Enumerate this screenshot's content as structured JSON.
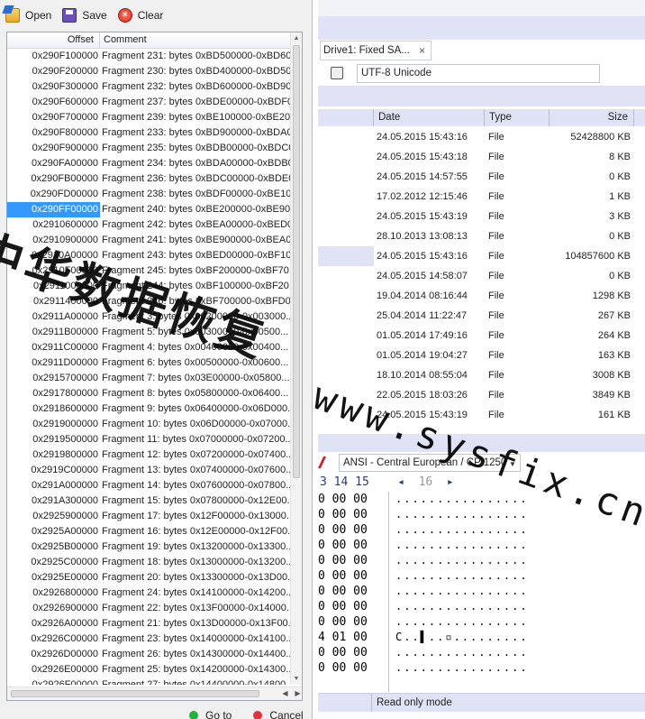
{
  "toolbar": {
    "open_label": "Open",
    "save_label": "Save",
    "clear_label": "Clear"
  },
  "list": {
    "headers": {
      "offset": "Offset",
      "comment": "Comment"
    },
    "rows": [
      {
        "offset": "0x290F100000",
        "comment": "Fragment 231: bytes 0xBD500000-0xBD60..."
      },
      {
        "offset": "0x290F200000",
        "comment": "Fragment 230: bytes 0xBD400000-0xBD50..."
      },
      {
        "offset": "0x290F300000",
        "comment": "Fragment 232: bytes 0xBD600000-0xBD90..."
      },
      {
        "offset": "0x290F600000",
        "comment": "Fragment 237: bytes 0xBDE00000-0xBDF0..."
      },
      {
        "offset": "0x290F700000",
        "comment": "Fragment 239: bytes 0xBE100000-0xBE20..."
      },
      {
        "offset": "0x290F800000",
        "comment": "Fragment 233: bytes 0xBD900000-0xBDA0..."
      },
      {
        "offset": "0x290F900000",
        "comment": "Fragment 235: bytes 0xBDB00000-0xBDC0..."
      },
      {
        "offset": "0x290FA00000",
        "comment": "Fragment 234: bytes 0xBDA00000-0xBDB0..."
      },
      {
        "offset": "0x290FB00000",
        "comment": "Fragment 236: bytes 0xBDC00000-0xBDE0..."
      },
      {
        "offset": "0x290FD00000",
        "comment": "Fragment 238: bytes 0xBDF00000-0xBE10..."
      },
      {
        "offset": "0x290FF00000",
        "comment": "Fragment 240: bytes 0xBE200000-0xBE90...",
        "selected": true
      },
      {
        "offset": "0x2910600000",
        "comment": "Fragment 242: bytes 0xBEA00000-0xBED0..."
      },
      {
        "offset": "0x2910900000",
        "comment": "Fragment 241: bytes 0xBE900000-0xBEA0..."
      },
      {
        "offset": "0x2910A00000",
        "comment": "Fragment 243: bytes 0xBED00000-0xBF10..."
      },
      {
        "offset": "0x2910F00000",
        "comment": "Fragment 245: bytes 0xBF200000-0xBF70..."
      },
      {
        "offset": "0x2911000000",
        "comment": "Fragment 244: bytes 0xBF100000-0xBF20..."
      },
      {
        "offset": "0x2911400000",
        "comment": "Fragment 246: bytes 0xBF700000-0xBFD0..."
      },
      {
        "offset": "0x2911A00000",
        "comment": "Fragment 3: bytes 0x00200000-0x003000..."
      },
      {
        "offset": "0x2911B00000",
        "comment": "Fragment 5: bytes 0x00300000-0x00500..."
      },
      {
        "offset": "0x2911C00000",
        "comment": "Fragment 4: bytes 0x00400000-0x00400..."
      },
      {
        "offset": "0x2911D00000",
        "comment": "Fragment 6: bytes 0x00500000-0x00600..."
      },
      {
        "offset": "0x2915700000",
        "comment": "Fragment 7: bytes 0x03E00000-0x05800..."
      },
      {
        "offset": "0x2917800000",
        "comment": "Fragment 8: bytes 0x05800000-0x06400..."
      },
      {
        "offset": "0x2918600000",
        "comment": "Fragment 9: bytes 0x06400000-0x06D000..."
      },
      {
        "offset": "0x2919000000",
        "comment": "Fragment 10: bytes 0x06D00000-0x07000..."
      },
      {
        "offset": "0x2919500000",
        "comment": "Fragment 11: bytes 0x07000000-0x07200..."
      },
      {
        "offset": "0x2919800000",
        "comment": "Fragment 12: bytes 0x07200000-0x07400..."
      },
      {
        "offset": "0x2919C00000",
        "comment": "Fragment 13: bytes 0x07400000-0x07600..."
      },
      {
        "offset": "0x291A000000",
        "comment": "Fragment 14: bytes 0x07600000-0x07800..."
      },
      {
        "offset": "0x291A300000",
        "comment": "Fragment 15: bytes 0x07800000-0x12E00..."
      },
      {
        "offset": "0x2925900000",
        "comment": "Fragment 17: bytes 0x12F00000-0x13000..."
      },
      {
        "offset": "0x2925A00000",
        "comment": "Fragment 16: bytes 0x12E00000-0x12F00..."
      },
      {
        "offset": "0x2925B00000",
        "comment": "Fragment 19: bytes 0x13200000-0x13300..."
      },
      {
        "offset": "0x2925C00000",
        "comment": "Fragment 18: bytes 0x13000000-0x13200..."
      },
      {
        "offset": "0x2925E00000",
        "comment": "Fragment 20: bytes 0x13300000-0x13D00..."
      },
      {
        "offset": "0x2926800000",
        "comment": "Fragment 24: bytes 0x14100000-0x14200..."
      },
      {
        "offset": "0x2926900000",
        "comment": "Fragment 22: bytes 0x13F00000-0x14000..."
      },
      {
        "offset": "0x2926A00000",
        "comment": "Fragment 21: bytes 0x13D00000-0x13F00..."
      },
      {
        "offset": "0x2926C00000",
        "comment": "Fragment 23: bytes 0x14000000-0x14100..."
      },
      {
        "offset": "0x2926D00000",
        "comment": "Fragment 26: bytes 0x14300000-0x14400..."
      },
      {
        "offset": "0x2926E00000",
        "comment": "Fragment 25: bytes 0x14200000-0x14300..."
      },
      {
        "offset": "0x2926F00000",
        "comment": "Fragment 27: bytes 0x14400000-0x14800..."
      }
    ]
  },
  "dialog_buttons": {
    "goto_label": "Go to",
    "cancel_label": "Cancel"
  },
  "app": {
    "tab_label": "Drive1: Fixed SA...",
    "tab_close": "×",
    "encoding": "UTF-8 Unicode",
    "columns": {
      "date": "Date",
      "type": "Type",
      "size": "Size"
    },
    "files": [
      {
        "date": "24.05.2015 15:43:16",
        "type": "File",
        "size": "52428800 KB"
      },
      {
        "date": "24.05.2015 15:43:18",
        "type": "File",
        "size": "8 KB"
      },
      {
        "date": "24.05.2015 14:57:55",
        "type": "File",
        "size": "0 KB"
      },
      {
        "date": "17.02.2012 12:15:46",
        "type": "File",
        "size": "1 KB"
      },
      {
        "date": "24.05.2015 15:43:19",
        "type": "File",
        "size": "3 KB"
      },
      {
        "date": "28.10.2013 13:08:13",
        "type": "File",
        "size": "0 KB"
      },
      {
        "date": "24.05.2015 15:43:16",
        "type": "File",
        "size": "104857600 KB",
        "highlight": true
      },
      {
        "date": "24.05.2015 14:58:07",
        "type": "File",
        "size": "0 KB"
      },
      {
        "date": "19.04.2014 08:16:44",
        "type": "File",
        "size": "1298 KB"
      },
      {
        "date": "25.04.2014 11:22:47",
        "type": "File",
        "size": "267 KB"
      },
      {
        "date": "01.05.2014 17:49:16",
        "type": "File",
        "size": "264 KB"
      },
      {
        "date": "01.05.2014 19:04:27",
        "type": "File",
        "size": "163 KB"
      },
      {
        "date": "18.10.2014 08:55:04",
        "type": "File",
        "size": "3008 KB"
      },
      {
        "date": "22.05.2015 18:03:26",
        "type": "File",
        "size": "3849 KB"
      },
      {
        "date": "24.05.2015 15:43:19",
        "type": "File",
        "size": "161 KB"
      }
    ],
    "char_encoding": "ANSI - Central European / CP 1250",
    "hex_header": {
      "cols": "3 14 15",
      "page": "16"
    },
    "hex_rows": [
      {
        "hex": "0 00 00",
        "text": "................"
      },
      {
        "hex": "0 00 00",
        "text": "................"
      },
      {
        "hex": "0 00 00",
        "text": "................"
      },
      {
        "hex": "0 00 00",
        "text": "................"
      },
      {
        "hex": "0 00 00",
        "text": "................"
      },
      {
        "hex": "0 00 00",
        "text": "................"
      },
      {
        "hex": "0 00 00",
        "text": "................"
      },
      {
        "hex": "0 00 00",
        "text": "................"
      },
      {
        "hex": "0 00 00",
        "text": "................"
      },
      {
        "hex": "4 01 00",
        "text": "C..▌..▫........."
      },
      {
        "hex": "0 00 00",
        "text": "................"
      },
      {
        "hex": "0 00 00",
        "text": "................"
      }
    ],
    "status_text": "Read only mode"
  },
  "watermark": {
    "cn": "中华数据恢复",
    "url": "www.sysfix.cn"
  }
}
